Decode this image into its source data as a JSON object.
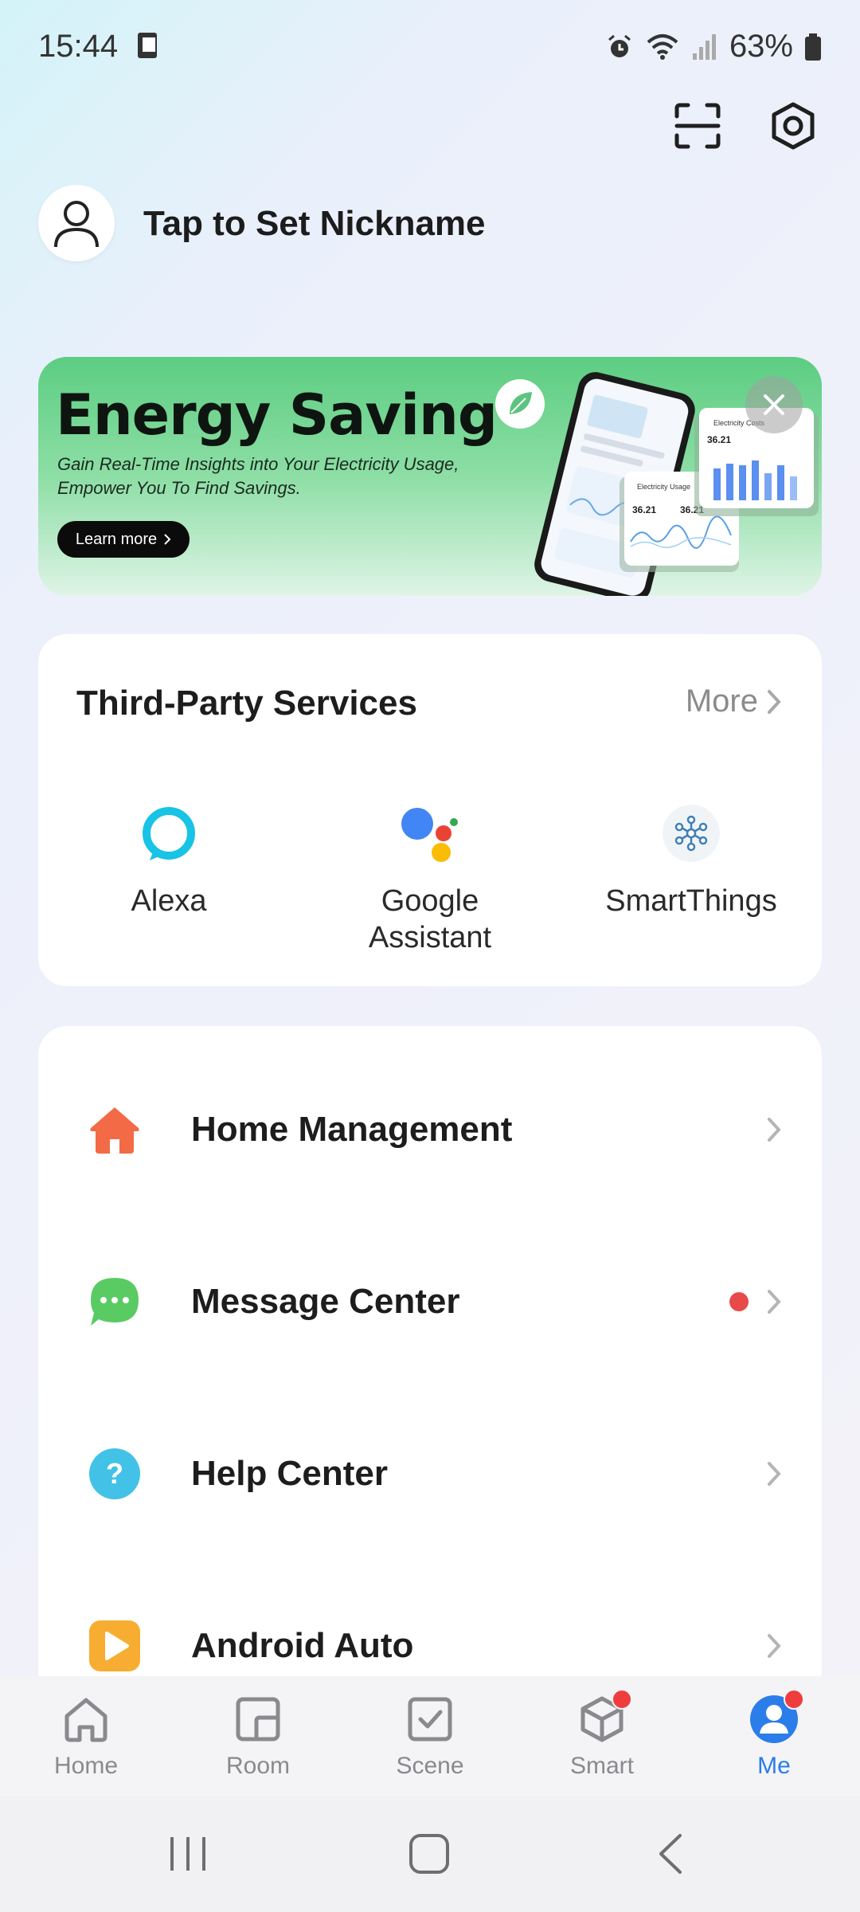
{
  "status_bar": {
    "time": "15:44",
    "battery": "63%"
  },
  "profile": {
    "nickname": "Tap to Set Nickname"
  },
  "banner": {
    "title": "Energy Saving",
    "subtitle_line1": "Gain Real-Time Insights into Your Electricity Usage,",
    "subtitle_line2": "Empower You To Find Savings.",
    "button": "Learn more",
    "card_label_1": "Electricity Costs",
    "card_value_1": "36.21",
    "card_label_2": "Electricity Usage",
    "card_value_2": "36.21",
    "card_value_3": "36.21"
  },
  "third_party": {
    "title": "Third-Party Services",
    "more": "More",
    "services": [
      {
        "label": "Alexa",
        "icon": "alexa-icon"
      },
      {
        "label_line1": "Google",
        "label_line2": "Assistant",
        "icon": "google-assistant-icon"
      },
      {
        "label": "SmartThings",
        "icon": "smartthings-icon"
      }
    ]
  },
  "menu": {
    "items": [
      {
        "label": "Home Management",
        "icon": "home-icon",
        "color": "#f26b46"
      },
      {
        "label": "Message Center",
        "icon": "message-icon",
        "color": "#5acb63",
        "unread": true
      },
      {
        "label": "Help Center",
        "icon": "help-icon",
        "color": "#43c2e8"
      },
      {
        "label": "Android Auto",
        "icon": "android-auto-icon",
        "color": "#f6ad32"
      }
    ]
  },
  "tabs": [
    {
      "label": "Home",
      "icon": "home-tab-icon"
    },
    {
      "label": "Room",
      "icon": "room-tab-icon"
    },
    {
      "label": "Scene",
      "icon": "scene-tab-icon"
    },
    {
      "label": "Smart",
      "icon": "smart-tab-icon",
      "badge": true
    },
    {
      "label": "Me",
      "icon": "me-tab-icon",
      "badge": true,
      "active": true
    }
  ],
  "colors": {
    "accent": "#2b7de9",
    "badge": "#ef3d3d",
    "banner_green": "#5ccd82"
  }
}
